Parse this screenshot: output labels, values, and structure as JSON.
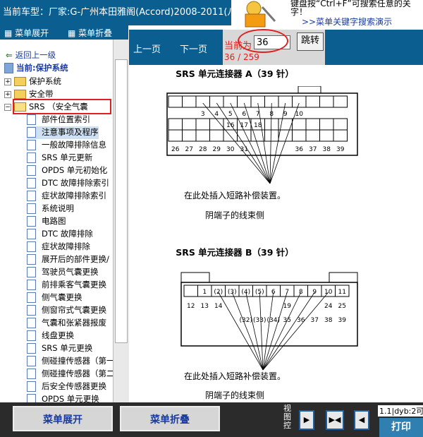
{
  "titlebar": {
    "text": "当前车型：厂家:G-广州本田雅阁(Accord)2008-2011(八代"
  },
  "promo": {
    "line1": "键盘按“Ctrl+F”可搜索任意的关",
    "line2": "字！",
    "link": ">>菜单关键字搜索演示"
  },
  "left_toolbar": {
    "expand": "菜单展开",
    "collapse": "菜单折叠"
  },
  "tree": {
    "back": "返回上一级",
    "current": "当前:保护系统",
    "folders": [
      "保护系统",
      "安全带",
      "SRS （安全气囊"
    ],
    "items": [
      "部件位置索引",
      "注意事项及程序",
      "一般故障排除信息",
      "SRS 单元更新",
      "OPDS 单元初始化",
      "DTC 故障排除索引",
      "症状故障排除索引",
      "系统说明",
      "电路图",
      "DTC 故障排除",
      "症状故障排除",
      "展开后的部件更换/",
      "驾驶员气囊更换",
      "前排乘客气囊更换",
      "侧气囊更换",
      "侧窗帘式气囊更换",
      "气囊和张紧器报废",
      "线盘更换",
      "SRS 单元更换",
      "侧碰撞传感器（第一",
      "侧碰撞传感器（第二",
      "后安全传感器更换",
      "OPDS 单元更换"
    ]
  },
  "nav": {
    "prev": "上一页",
    "next": "下一页",
    "current_label": "当前为",
    "page_value": "36",
    "page_count": "36 / 259",
    "jump": "跳转"
  },
  "diagram_a": {
    "title": "SRS 单元连接器 A（39 针）",
    "top_pins": [
      "3",
      "4",
      "5",
      "6",
      "7",
      "8",
      "9",
      "10"
    ],
    "mid_pins": [
      "16",
      "17",
      "18"
    ],
    "bottom_pins": [
      "26",
      "27",
      "28",
      "29",
      "30",
      "31",
      "36",
      "37",
      "38",
      "39"
    ],
    "note": "在此处插入短路补偿装置。",
    "side": "阴端子的线束侧"
  },
  "diagram_b": {
    "title": "SRS 单元连接器 B（39 针）",
    "top_pins": [
      "1",
      "(2)",
      "(3)",
      "(4)",
      "(5)",
      "6",
      "7",
      "8",
      "9",
      "10",
      "11"
    ],
    "mid_pins": [
      "12",
      "13",
      "14",
      "19",
      "24",
      "25"
    ],
    "bottom_pins": [
      "(32)",
      "(33)",
      "(34)",
      "35",
      "36",
      "37",
      "38",
      "39"
    ],
    "note": "在此处插入短路补偿装置。",
    "side": "阴端子的线束侧"
  },
  "bottom": {
    "expand": "菜单展开",
    "collapse": "菜单折叠",
    "view_label": "视图控",
    "status": "1.1|dyb:2可",
    "print": "打印"
  },
  "colors": {
    "nav_bg": "#0b5f90",
    "highlight": "#e02020",
    "link": "#1a3aa0"
  }
}
